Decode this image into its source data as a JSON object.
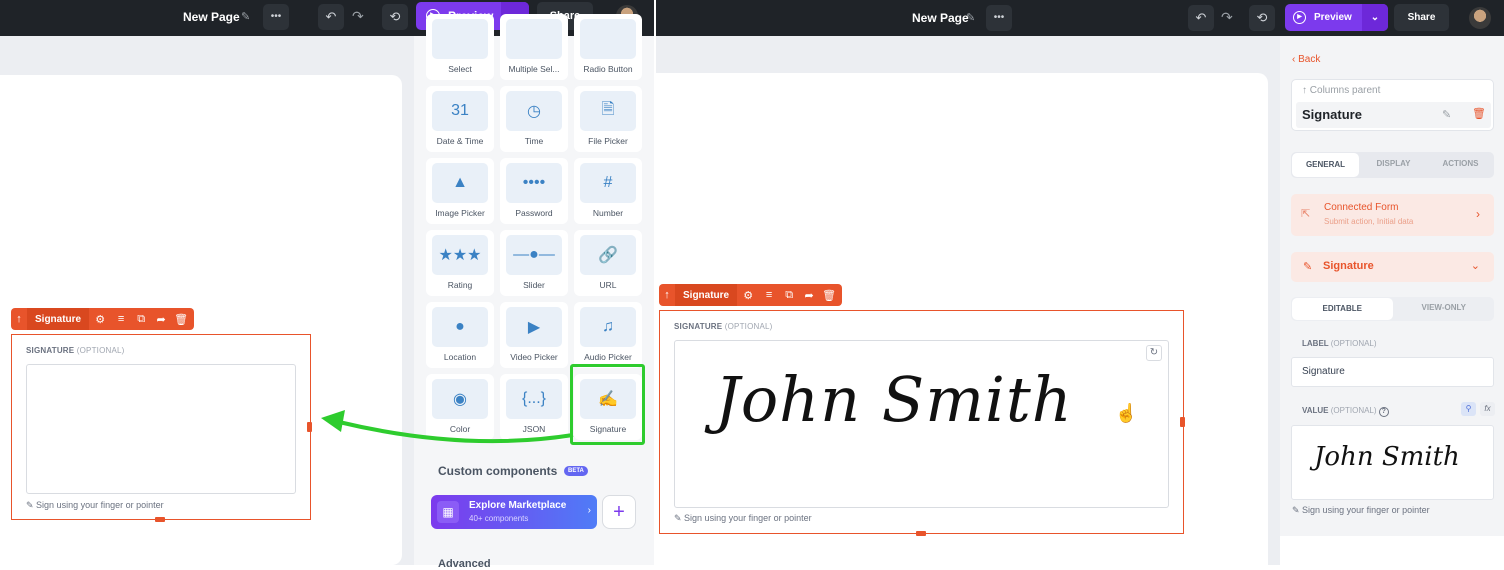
{
  "left_editor": {
    "topbar": {
      "page_title": "New Page",
      "more_label": "•••",
      "preview_label": "Preview",
      "share_label": "Share"
    },
    "toolbar_label": "Signature",
    "field_label": "SIGNATURE",
    "field_optional": "(OPTIONAL)",
    "hint": "Sign using your finger or pointer"
  },
  "palette": {
    "row0": [
      "Select",
      "Multiple Sel...",
      "Radio Button"
    ],
    "tiles": [
      {
        "label": "Date & Time",
        "icon": "calendar-icon",
        "glyph": "31"
      },
      {
        "label": "Time",
        "icon": "clock-icon",
        "glyph": "◷"
      },
      {
        "label": "File Picker",
        "icon": "file-icon",
        "glyph": "🗎"
      },
      {
        "label": "Image Picker",
        "icon": "image-icon",
        "glyph": "▲"
      },
      {
        "label": "Password",
        "icon": "password-icon",
        "glyph": "••••"
      },
      {
        "label": "Number",
        "icon": "number-icon",
        "glyph": "#"
      },
      {
        "label": "Rating",
        "icon": "star-icon",
        "glyph": "★★★"
      },
      {
        "label": "Slider",
        "icon": "slider-icon",
        "glyph": "—●—"
      },
      {
        "label": "URL",
        "icon": "link-icon",
        "glyph": "🔗"
      },
      {
        "label": "Location",
        "icon": "location-icon",
        "glyph": "●"
      },
      {
        "label": "Video Picker",
        "icon": "video-icon",
        "glyph": "▶"
      },
      {
        "label": "Audio Picker",
        "icon": "audio-icon",
        "glyph": "♫"
      },
      {
        "label": "Color",
        "icon": "palette-icon",
        "glyph": "◉"
      },
      {
        "label": "JSON",
        "icon": "json-icon",
        "glyph": "{...}"
      },
      {
        "label": "Signature",
        "icon": "signature-icon",
        "glyph": "✍"
      }
    ],
    "custom_title": "Custom components",
    "beta": "BETA",
    "market_title": "Explore Marketplace",
    "market_sub": "40+ components",
    "advanced_title": "Advanced"
  },
  "right_editor": {
    "topbar": {
      "page_title": "New Page",
      "more_label": "•••",
      "preview_label": "Preview",
      "share_label": "Share"
    },
    "toolbar_label": "Signature",
    "field_label": "SIGNATURE",
    "field_optional": "(OPTIONAL)",
    "signature_text": "John Smith",
    "hint": "Sign using your finger or pointer"
  },
  "panel": {
    "back": "Back",
    "parent": "Columns parent",
    "component_name": "Signature",
    "tabs": [
      "GENERAL",
      "DISPLAY",
      "ACTIONS"
    ],
    "connected_title": "Connected Form",
    "connected_sub": "Submit action, Initial data",
    "section_title": "Signature",
    "mode_tabs": [
      "EDITABLE",
      "VIEW-ONLY"
    ],
    "label_title": "LABEL",
    "label_optional": "(OPTIONAL)",
    "label_value": "Signature",
    "value_title": "VALUE",
    "value_optional": "(OPTIONAL)",
    "fx": "fx",
    "value_signature": "John Smith",
    "hint": "Sign using your finger or pointer"
  },
  "colors": {
    "accent": "#e8542b",
    "brand": "#7c3aed",
    "highlight": "#2ecc2e"
  }
}
